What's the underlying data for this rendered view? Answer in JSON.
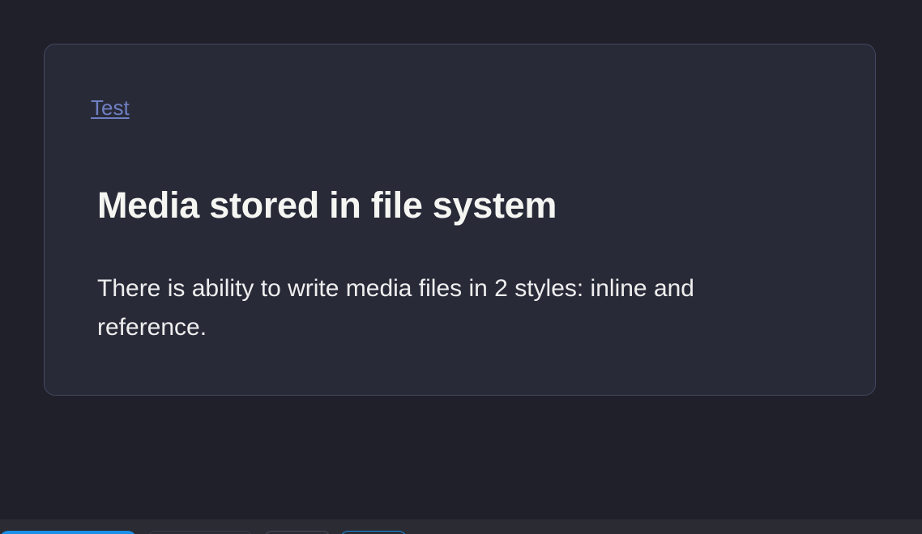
{
  "card": {
    "link_label": "Test",
    "title": "Media stored in file system",
    "description": "There is ability to write media files in 2 styles: inline and reference."
  },
  "colors": {
    "background": "#1f2029",
    "card": "#282a38",
    "link": "#6e7fc2",
    "accent": "#1a8fe8"
  }
}
